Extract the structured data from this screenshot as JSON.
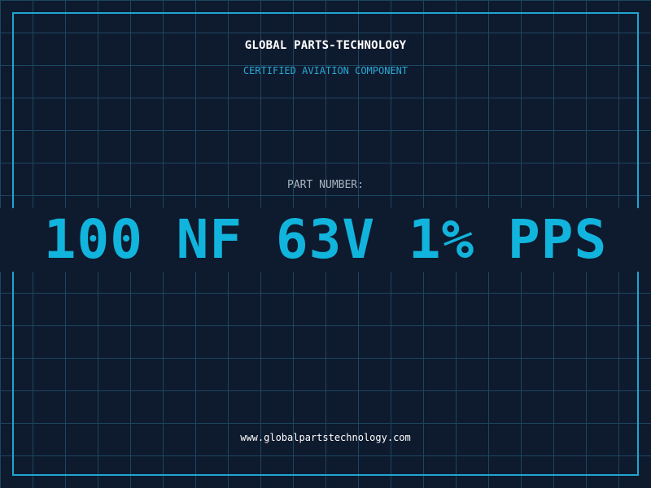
{
  "header": {
    "brand": "GLOBAL PARTS-TECHNOLOGY",
    "tagline": "CERTIFIED AVIATION COMPONENT"
  },
  "part": {
    "label": "PART NUMBER:",
    "number": "100 NF 63V 1% PPS"
  },
  "footer": {
    "website": "www.globalpartstechnology.com"
  },
  "colors": {
    "background": "#0e1a2e",
    "grid": "#1d4660",
    "accent": "#11b4dc",
    "border": "#1ea6cf"
  }
}
